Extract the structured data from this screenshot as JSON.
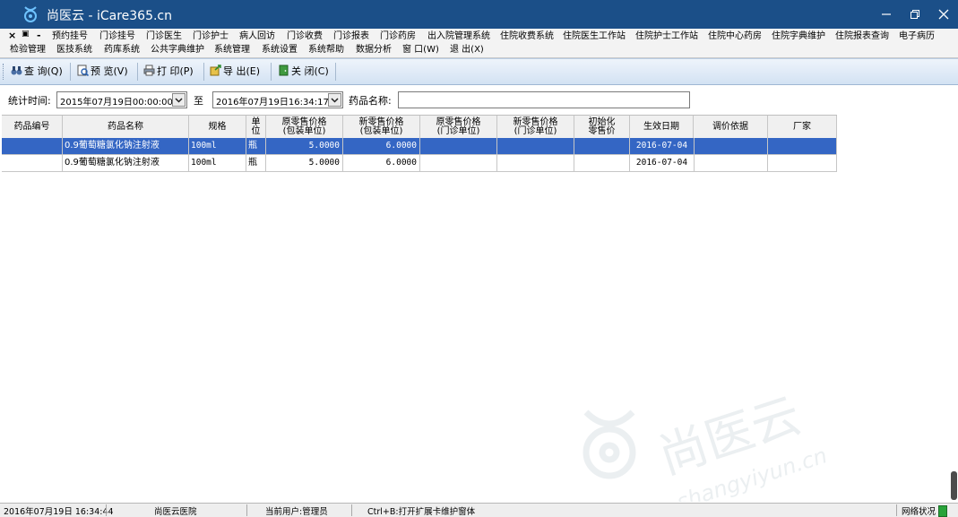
{
  "window": {
    "title": "尚医云 - iCare365.cn",
    "controls": [
      "minimize",
      "maximize",
      "close"
    ]
  },
  "menu": {
    "row1": [
      "预约挂号",
      "门诊挂号",
      "门诊医生",
      "门诊护士",
      "病人回访",
      "门诊收费",
      "门诊报表",
      "门诊药房",
      "出入院管理系统",
      "住院收费系统",
      "住院医生工作站",
      "住院护士工作站",
      "住院中心药房",
      "住院字典维护",
      "住院报表查询",
      "电子病历"
    ],
    "row2": [
      "检验管理",
      "医技系统",
      "药库系统",
      "公共字典维护",
      "系统管理",
      "系统设置",
      "系统帮助",
      "数据分析",
      "窗 口(W)",
      "退 出(X)"
    ],
    "mdi_controls": [
      "close-child",
      "restore-child",
      "minimize-child"
    ]
  },
  "toolbar": {
    "query": "查 询(Q)",
    "preview": "预 览(V)",
    "print": "打 印(P)",
    "export": "导 出(E)",
    "close": "关 闭(C)"
  },
  "filter": {
    "time_label": "统计时间:",
    "start": "2015年07月19日00:00:00",
    "to_label": "至",
    "end": "2016年07月19日16:34:17",
    "name_label": "药品名称:",
    "name_value": ""
  },
  "table": {
    "columns": [
      "药品编号",
      "药品名称",
      "规格",
      "单\n位",
      "原零售价格\n(包装单位)",
      "新零售价格\n(包装单位)",
      "原零售价格\n(门诊单位)",
      "新零售价格\n(门诊单位)",
      "初始化\n零售价",
      "生效日期",
      "调价依据",
      "厂家"
    ],
    "rows": [
      [
        "",
        "0.9葡萄糖氯化钠注射液",
        "100ml",
        "瓶",
        "5.0000",
        "6.0000",
        "",
        "",
        "",
        "2016-07-04",
        "",
        ""
      ],
      [
        "",
        "0.9葡萄糖氯化钠注射液",
        "100ml",
        "瓶",
        "5.0000",
        "6.0000",
        "",
        "",
        "",
        "2016-07-04",
        "",
        ""
      ]
    ],
    "selected_row": 0
  },
  "watermark": {
    "brand": "尚医云",
    "domain": "shangyiyun.cn"
  },
  "status": {
    "datetime": "2016年07月19日 16:34:44",
    "hospital": "尚医云医院",
    "user": "当前用户:管理员",
    "hint": "Ctrl+B:打开扩展卡维护窗体",
    "network": "网络状况"
  },
  "colors": {
    "titlebar": "#1b4f88",
    "selection": "#3466c4",
    "network_ok": "#29a33a"
  }
}
